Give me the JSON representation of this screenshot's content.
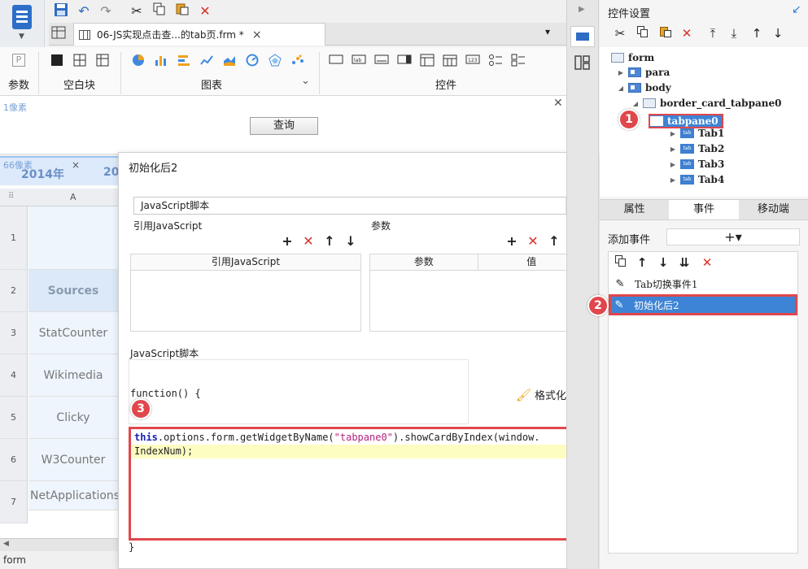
{
  "toolbar": {
    "file_tab_title": "06-JS实现点击查...的tab页.frm *",
    "file_tab_close": "×",
    "collapse_toggle": "▾",
    "icons": [
      "save-icon",
      "undo-icon",
      "redo-icon",
      "cut-icon",
      "copy-icon",
      "paste-icon",
      "delete-icon"
    ]
  },
  "ribbon": {
    "groups": [
      "参数",
      "空白块",
      "图表",
      "控件"
    ],
    "param_icon_letter": "P",
    "chart_expand": "⌄"
  },
  "canvas": {
    "pixel_top": "1像素",
    "query_button": "查询",
    "pixel_sheet": "66像素",
    "sheet_tabs": [
      "2014年",
      "20"
    ],
    "sheet_tab_close": "×",
    "column_header": "A",
    "rows": [
      {
        "num": "1",
        "value": ""
      },
      {
        "num": "2",
        "value": "Sources"
      },
      {
        "num": "3",
        "value": "StatCounter"
      },
      {
        "num": "4",
        "value": "Wikimedia"
      },
      {
        "num": "5",
        "value": "Clicky"
      },
      {
        "num": "6",
        "value": "W3Counter"
      },
      {
        "num": "7",
        "value": "NetApplications"
      }
    ],
    "status": "form"
  },
  "dialog": {
    "title": "初始化后2",
    "script_type": "JavaScript脚本",
    "ref_js_section": "引用JavaScript",
    "param_section": "参数",
    "ref_js_col": "引用JavaScript",
    "param_cols": [
      "参数",
      "值"
    ],
    "script_section": "JavaScript脚本",
    "func_signature": "function() {",
    "format_button": "格式化代码",
    "code_kw": "this",
    "code_mid": ".options.form.getWidgetByName(",
    "code_str": "\"tabpane0\"",
    "code_tail": ").showCardByIndex(window.",
    "code_line2": "IndexNum);",
    "close_brace": "}"
  },
  "markers": [
    "1",
    "2",
    "3"
  ],
  "right_panel": {
    "title": "控件设置",
    "tree": {
      "form": "form",
      "para": "para",
      "body": "body",
      "container": "border_card_tabpane0",
      "tabpane": "tabpane0",
      "tabs": [
        "Tab1",
        "Tab2",
        "Tab3",
        "Tab4"
      ],
      "tab_icon_text": "tab"
    },
    "tabs": [
      "属性",
      "事件",
      "移动端"
    ],
    "add_event_label": "添加事件",
    "add_event_button": "+▾",
    "events": [
      "Tab切换事件1",
      "初始化后2"
    ]
  }
}
